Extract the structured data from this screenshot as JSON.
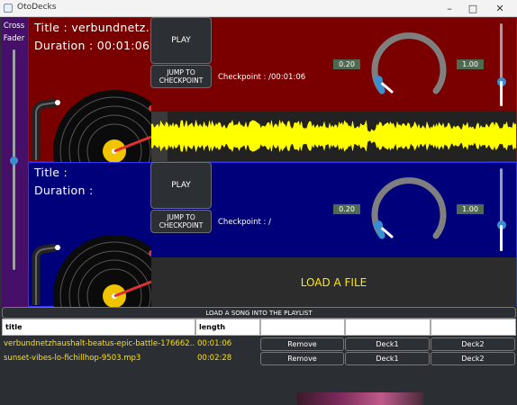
{
  "window": {
    "title": "OtoDecks"
  },
  "crossfader": {
    "label_line1": "Cross",
    "label_line2": "Fader"
  },
  "deck1": {
    "title_text": "Title : verbundnetz...",
    "duration_text": "Duration : 00:01:06",
    "play_label": "PLAY",
    "jump_line1": "JUMP TO",
    "jump_line2": "CHECKPOINT",
    "checkpoint_text": "Checkpoint :  /00:01:06",
    "speed_value": "0.20",
    "volume_value": "1.00",
    "speed_level": 0.2,
    "volume_level": 1.0
  },
  "deck2": {
    "title_text": "Title :",
    "duration_text": "Duration :",
    "play_label": "PLAY",
    "jump_line1": "JUMP TO",
    "jump_line2": "CHECKPOINT",
    "checkpoint_text": "Checkpoint :  /",
    "speed_value": "0.20",
    "volume_value": "1.00",
    "load_label": "LOAD A FILE",
    "speed_level": 0.2,
    "volume_level": 1.0
  },
  "playlist": {
    "header": "LOAD A SONG INTO THE PLAYLIST",
    "columns": [
      "title",
      "length",
      "",
      "",
      ""
    ],
    "rows": [
      {
        "title": "verbundnetzhaushalt-beatus-epic-battle-176662....",
        "length": "00:01:06",
        "remove": "Remove",
        "deck1": "Deck1",
        "deck2": "Deck2"
      },
      {
        "title": "sunset-vibes-lo-fichillhop-9503.mp3",
        "length": "00:02:28",
        "remove": "Remove",
        "deck1": "Deck1",
        "deck2": "Deck2"
      }
    ]
  },
  "colors": {
    "deck1_bg": "#7a0000",
    "deck2_bg": "#00007a",
    "waveform": "#ffff00",
    "crossfader_bg": "#46106a",
    "accent": "#3a8fd0",
    "playlist_text": "#ffe000"
  }
}
